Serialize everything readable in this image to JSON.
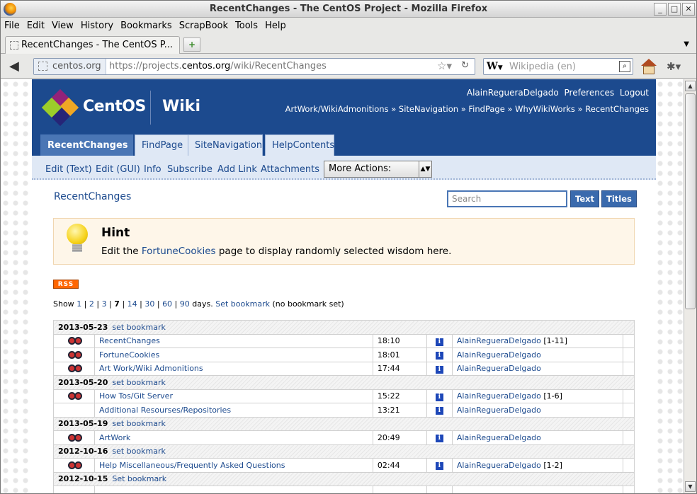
{
  "window": {
    "title": "RecentChanges - The CentOS Project - Mozilla Firefox"
  },
  "menubar": [
    "File",
    "Edit",
    "View",
    "History",
    "Bookmarks",
    "ScrapBook",
    "Tools",
    "Help"
  ],
  "tab": {
    "label": "RecentChanges - The CentOS P..."
  },
  "nav": {
    "site": "centos.org",
    "url_prefix": "https://projects.",
    "url_domain": "centos.org",
    "url_path": "/wiki/RecentChanges",
    "search_placeholder": "Wikipedia (en)",
    "search_engine": "W"
  },
  "wiki": {
    "logo_text": "CentOS",
    "wiki_text": "Wiki",
    "user": "AlainRegueraDelgado",
    "preferences": "Preferences",
    "logout": "Logout",
    "trail": "ArtWork/WikiAdmonitions » SiteNavigation » FindPage » WhyWikiWorks » RecentChanges",
    "tabs": [
      "RecentChanges",
      "FindPage",
      "SiteNavigation",
      "HelpContents"
    ],
    "actions": [
      "Edit (Text)",
      "Edit (GUI)",
      "Info",
      "Subscribe",
      "Add Link",
      "Attachments"
    ],
    "more_actions": "More Actions:",
    "page_name": "RecentChanges",
    "search_placeholder": "Search",
    "btn_text": "Text",
    "btn_titles": "Titles"
  },
  "hint": {
    "title": "Hint",
    "text_before": "Edit the ",
    "link": "FortuneCookies",
    "text_after": " page to display randomly selected wisdom here."
  },
  "rss": "RSS",
  "show": {
    "prefix": "Show ",
    "days": [
      "1",
      "2",
      "3",
      "7",
      "14",
      "30",
      "60",
      "90"
    ],
    "current": "7",
    "suffix": " days. ",
    "set_bookmark": "Set bookmark",
    "note": " (no bookmark set)"
  },
  "changes": [
    {
      "date": "2013-05-23",
      "action": "set bookmark",
      "rows": [
        {
          "icon": true,
          "page": "RecentChanges",
          "time": "18:10",
          "editor": "AlainRegueraDelgado",
          "count": "[1-11]"
        },
        {
          "icon": true,
          "page": "FortuneCookies",
          "time": "18:01",
          "editor": "AlainRegueraDelgado",
          "count": ""
        },
        {
          "icon": true,
          "page": "Art Work/Wiki Admonitions",
          "time": "17:44",
          "editor": "AlainRegueraDelgado",
          "count": ""
        }
      ]
    },
    {
      "date": "2013-05-20",
      "action": "set bookmark",
      "rows": [
        {
          "icon": true,
          "page": "How Tos/Git Server",
          "time": "15:22",
          "editor": "AlainRegueraDelgado",
          "count": "[1-6]"
        },
        {
          "icon": false,
          "page": "Additional Resourses/Repositories",
          "time": "13:21",
          "editor": "AlainRegueraDelgado",
          "count": ""
        }
      ]
    },
    {
      "date": "2013-05-19",
      "action": "set bookmark",
      "rows": [
        {
          "icon": true,
          "page": "ArtWork",
          "time": "20:49",
          "editor": "AlainRegueraDelgado",
          "count": ""
        }
      ]
    },
    {
      "date": "2012-10-16",
      "action": "set bookmark",
      "rows": [
        {
          "icon": true,
          "page": "Help Miscellaneous/Frequently Asked Questions",
          "time": "02:44",
          "editor": "AlainRegueraDelgado",
          "count": "[1-2]"
        }
      ]
    },
    {
      "date": "2012-10-15",
      "action": "Set bookmark",
      "rows": [
        {
          "icon": false,
          "page": "",
          "time": "",
          "editor": "",
          "count": ""
        }
      ]
    }
  ],
  "colors": {
    "header": "#1c4a8e",
    "tab_active": "#4a76b5",
    "link": "#1c4a8e",
    "hint_bg": "#fef6e9",
    "rss": "#ff6600"
  }
}
